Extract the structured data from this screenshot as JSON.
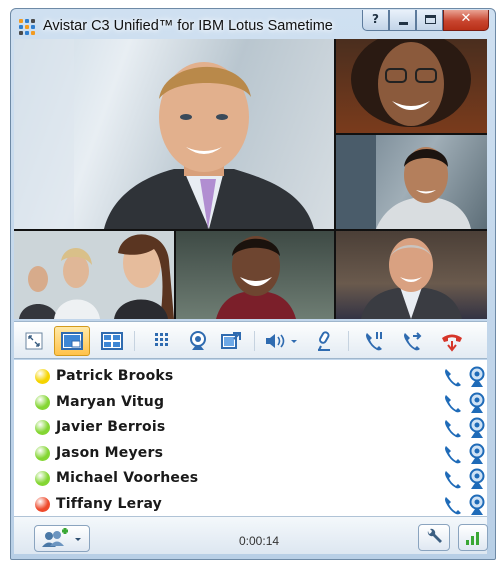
{
  "window": {
    "title": "Avistar C3 Unified™ for IBM Lotus Sametime",
    "controls": {
      "help_glyph": "?",
      "close_glyph": "✕"
    }
  },
  "video": {
    "tiles": [
      {
        "name": "main-speaker-video"
      },
      {
        "name": "woman-glasses-video"
      },
      {
        "name": "young-man-video"
      },
      {
        "name": "group-video"
      },
      {
        "name": "smiling-man-video"
      },
      {
        "name": "bald-man-video"
      }
    ]
  },
  "toolbar": {
    "icons": [
      "fullscreen-icon",
      "picture-in-picture-icon",
      "grid-layout-icon",
      "keypad-icon",
      "webcam-icon",
      "share-screen-icon",
      "speaker-volume-icon",
      "microphone-icon",
      "hold-call-icon",
      "transfer-call-icon",
      "end-call-icon"
    ],
    "active": "picture-in-picture-icon"
  },
  "participants": [
    {
      "name": "Patrick Brooks",
      "status_color": "#f5d400"
    },
    {
      "name": "Maryan Vitug",
      "status_color": "#84d633"
    },
    {
      "name": "Javier Berrois",
      "status_color": "#84d633"
    },
    {
      "name": "Jason Meyers",
      "status_color": "#84d633"
    },
    {
      "name": "Michael Voorhees",
      "status_color": "#84d633"
    },
    {
      "name": "Tiffany Leray",
      "status_color": "#ee4a2c"
    }
  ],
  "status": {
    "timer": "0:00:14",
    "add_participant_icon": "add-people-icon",
    "settings_icon": "wrench-icon",
    "signal_icon": "signal-bars-icon"
  },
  "colors": {
    "accent_active": "#ffc24a",
    "phone_blue": "#1f6bb8",
    "close_red": "#c8452f"
  }
}
